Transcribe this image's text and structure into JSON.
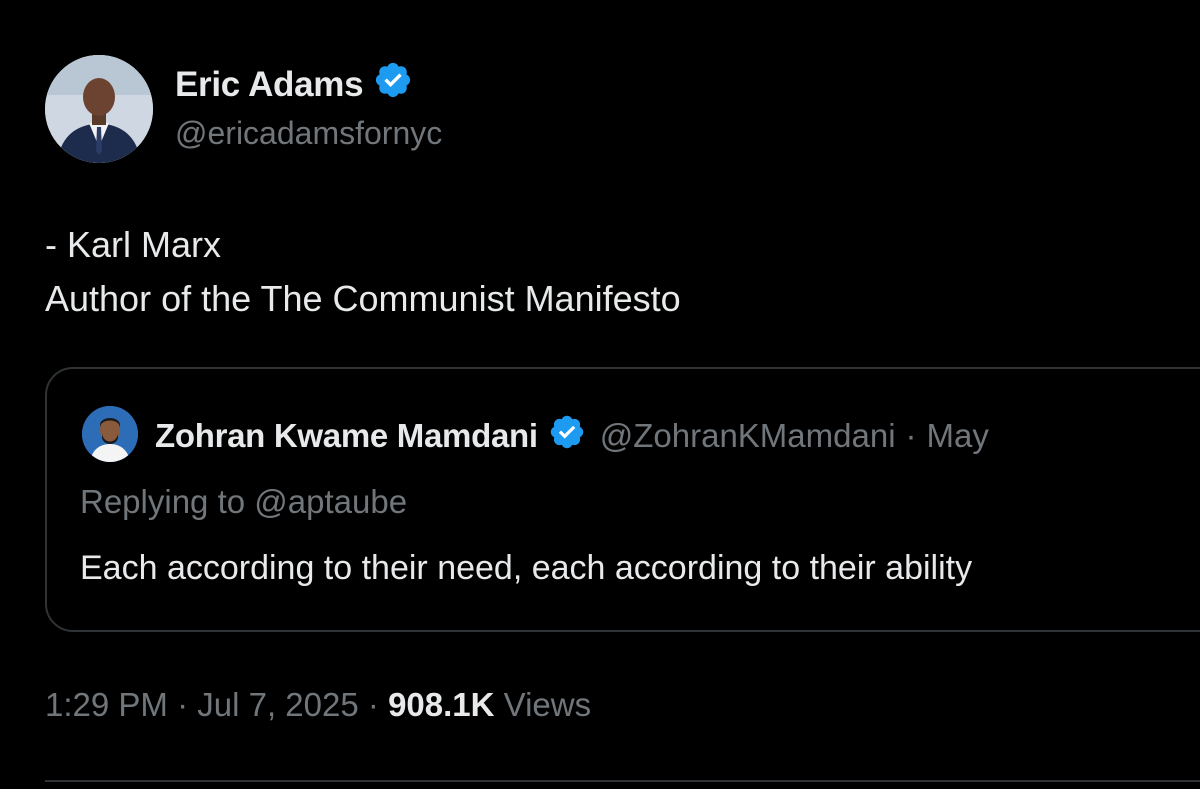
{
  "tweet": {
    "author": {
      "name": "Eric Adams",
      "handle": "@ericadamsfornyc",
      "verified": true,
      "avatar": "avatar-photo"
    },
    "text_lines": [
      "- Karl Marx",
      "Author of the The Communist Manifesto"
    ],
    "quote": {
      "author_name": "Zohran Kwame Mamdani",
      "author_handle": "@ZohranKMamdani",
      "separator": "·",
      "date": "May",
      "verified": true,
      "replying_to": "Replying to @aptaube",
      "text": "Each according to their need, each according to their ability"
    },
    "meta": {
      "time": "1:29 PM",
      "separator": "·",
      "date": "Jul 7, 2025",
      "views_count": "908.1K",
      "views_label": "Views"
    }
  },
  "colors": {
    "background": "#000000",
    "primary_text": "#e7e9ea",
    "secondary_text": "#71767b",
    "verified_badge": "#1d9bf0",
    "border": "#2f3336"
  }
}
